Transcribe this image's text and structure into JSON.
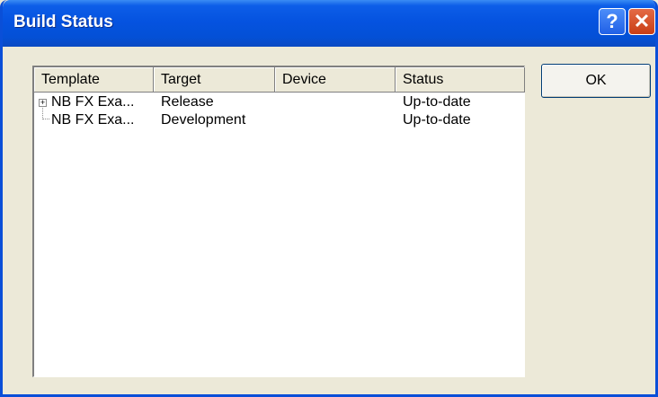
{
  "window": {
    "title": "Build Status",
    "help_glyph": "?",
    "close_glyph": "✕"
  },
  "list": {
    "columns": [
      "Template",
      "Target",
      "Device",
      "Status"
    ],
    "rows": [
      {
        "template": "NB FX Exa...",
        "target": "Release",
        "device": "",
        "status": "Up-to-date",
        "expander": "+"
      },
      {
        "template": "NB FX Exa...",
        "target": "Development",
        "device": "",
        "status": "Up-to-date"
      }
    ]
  },
  "buttons": {
    "ok_label": "OK"
  }
}
